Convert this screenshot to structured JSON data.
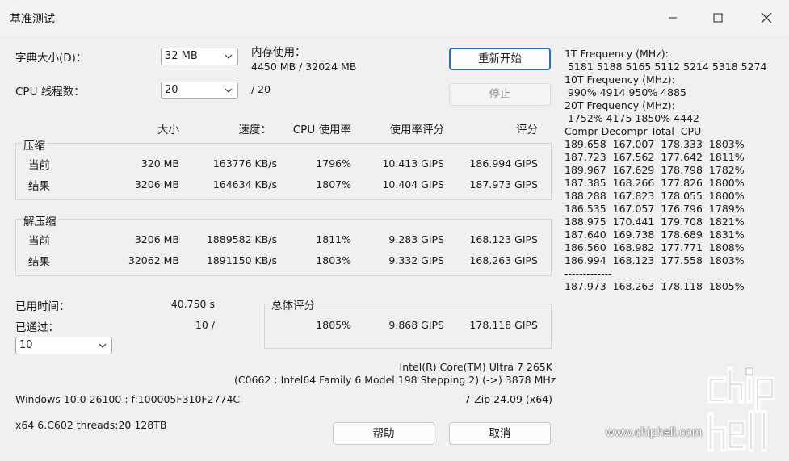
{
  "window": {
    "title": "基准测试"
  },
  "settings": {
    "dict_label": "字典大小(D)：",
    "dict_value": "32 MB",
    "mem_label": "内存使用：",
    "mem_value": "4450 MB / 32024 MB",
    "threads_label": "CPU 线程数：",
    "threads_value": "20",
    "threads_total": "/ 20"
  },
  "buttons": {
    "restart": "重新开始",
    "stop": "停止",
    "help": "帮助",
    "cancel": "取消"
  },
  "table": {
    "headers": [
      "大小",
      "速度：",
      "CPU 使用率",
      "使用率评分",
      "评分"
    ],
    "compress_title": "压缩",
    "decompress_title": "解压缩",
    "compress_rows": [
      {
        "label": "当前",
        "size": "320 MB",
        "speed": "163776 KB/s",
        "cpu": "1796%",
        "rating": "10.413 GIPS",
        "score": "186.994 GIPS"
      },
      {
        "label": "结果",
        "size": "3206 MB",
        "speed": "164634 KB/s",
        "cpu": "1807%",
        "rating": "10.404 GIPS",
        "score": "187.973 GIPS"
      }
    ],
    "decompress_rows": [
      {
        "label": "当前",
        "size": "3206 MB",
        "speed": "1889582 KB/s",
        "cpu": "1811%",
        "rating": "9.283 GIPS",
        "score": "168.123 GIPS"
      },
      {
        "label": "结果",
        "size": "32062 MB",
        "speed": "1891150 KB/s",
        "cpu": "1803%",
        "rating": "9.332 GIPS",
        "score": "168.263 GIPS"
      }
    ]
  },
  "elapsed": {
    "label": "已用时间：",
    "value": "40.750 s"
  },
  "passes": {
    "label": "已通过：",
    "value": "10 /",
    "select_value": "10"
  },
  "total": {
    "title": "总体评分",
    "cpu": "1805%",
    "rating": "9.868 GIPS",
    "score": "178.118 GIPS"
  },
  "cpu_info": {
    "name": "Intel(R) Core(TM) Ultra 7 265K",
    "details": "(C0662 : Intel64 Family 6 Model 198 Stepping 2) (->) 3878 MHz"
  },
  "os": {
    "windows": "Windows 10.0 26100 : f:100005F310F2774C",
    "version": "7-Zip 24.09 (x64)",
    "arch": "x64 6.C602 threads:20 128TB"
  },
  "freq": {
    "t1_label": "1T Frequency (MHz):",
    "t1_values": " 5181 5188 5165 5112 5214 5318 5274",
    "t10_label": "10T Frequency (MHz):",
    "t10_values": " 990% 4914 950% 4885",
    "t20_label": "20T Frequency (MHz):",
    "t20_values": " 1752% 4175 1850% 4442",
    "header": "Compr Decompr Total  CPU",
    "rows": [
      "189.658  167.007  178.333  1803%",
      "187.723  167.562  177.642  1811%",
      "189.967  167.629  178.798  1782%",
      "187.385  168.266  177.826  1800%",
      "188.288  167.823  178.055  1800%",
      "186.535  167.057  176.796  1789%",
      "188.975  170.441  179.708  1821%",
      "187.640  169.738  178.689  1831%",
      "186.560  168.982  177.771  1808%",
      "186.994  168.123  177.558  1803%"
    ],
    "separator": "-------------",
    "summary": "187.973  168.263  178.118  1805%"
  },
  "watermark": {
    "logo": "chiphell",
    "url": "www.chiphell.com"
  }
}
